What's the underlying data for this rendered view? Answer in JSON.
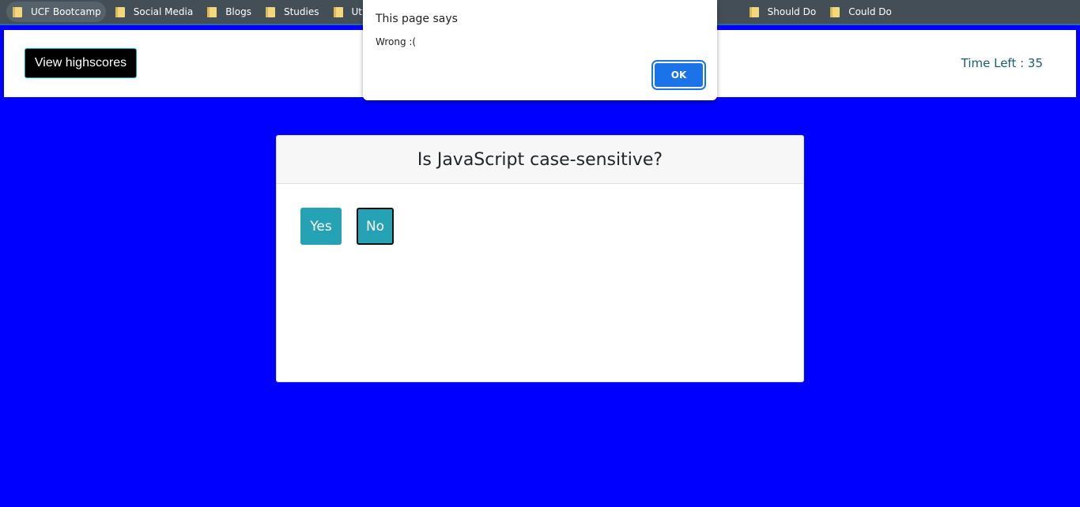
{
  "bookmarks": [
    {
      "label": "UCF Bootcamp",
      "icon": "folder-icon"
    },
    {
      "label": "Social Media",
      "icon": "folder-icon"
    },
    {
      "label": "Blogs",
      "icon": "folder-icon"
    },
    {
      "label": "Studies",
      "icon": "folder-icon"
    },
    {
      "label": "Utilities",
      "icon": "folder-icon"
    },
    {
      "label": "Should Do",
      "icon": "folder-icon"
    },
    {
      "label": "Could Do",
      "icon": "folder-icon"
    }
  ],
  "header": {
    "highscores_label": "View highscores",
    "timer_text": "Time Left : 35"
  },
  "quiz": {
    "question": "Is JavaScript case-sensitive?",
    "answers": [
      "Yes",
      "No"
    ]
  },
  "alert": {
    "title": "This page says",
    "message": "Wrong :(",
    "ok_label": "OK"
  },
  "colors": {
    "page_background": "#0000ff",
    "answer_button": "#26a2b5",
    "timer_text": "#17606b",
    "ok_button": "#1a73e8"
  }
}
